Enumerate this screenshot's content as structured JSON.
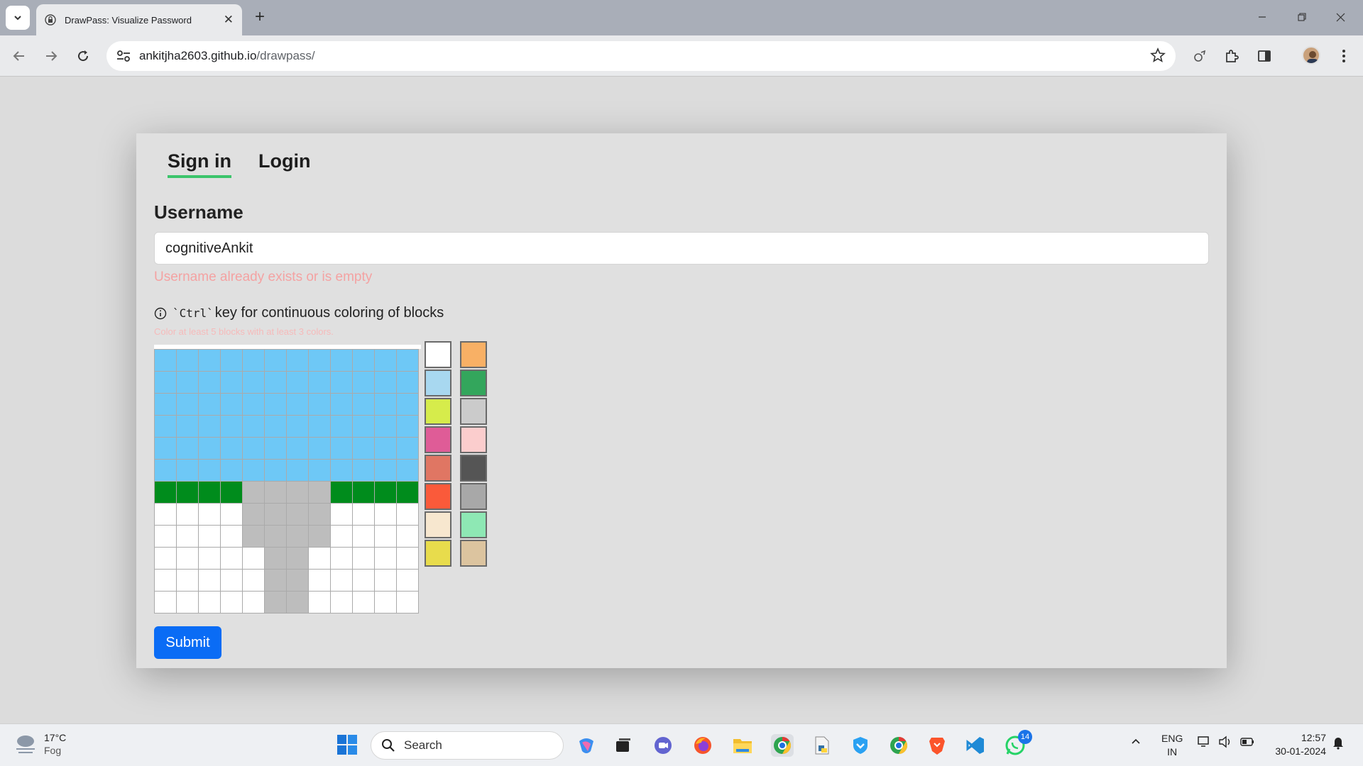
{
  "browser": {
    "tab_title": "DrawPass: Visualize Password",
    "url_host": "ankitjha2603.github.io",
    "url_path": "/drawpass/"
  },
  "page": {
    "tabs": [
      "Sign in",
      "Login"
    ],
    "active_tab": "Sign in",
    "username_label": "Username",
    "username_value": "cognitiveAnkit",
    "username_error": "Username already exists or is empty",
    "hint_code": "`Ctrl`",
    "hint_text": "key for continuous coloring of blocks",
    "grid_error": "Color at least 5 blocks with at least 3 colors.",
    "submit_label": "Submit",
    "grid_colors": [
      "#6ec8f6",
      "#008c1c",
      "#bdbdbd",
      "#ffffff"
    ],
    "grid_rows": [
      "AAAAAAAAAAAA",
      "AAAAAAAAAAAA",
      "AAAAAAAAAAAA",
      "AAAAAAAAAAAA",
      "AAAAAAAAAAAA",
      "AAAAAAAAAAAA",
      "BBBBCCCCBBBB",
      "WWWWCCCCWWWW",
      "WWWWCCCCWWWW",
      "WWWWWCCWWWWW",
      "WWWWWCCWWWWW",
      "WWWWWCCWWWWW"
    ],
    "palette_left": [
      "#ffffff",
      "#a8d8f0",
      "#d6ec4b",
      "#df5c97",
      "#e07663",
      "#fa5a3a",
      "#f7e7cf",
      "#e8dc4c"
    ],
    "palette_right": [
      "#f8b065",
      "#33a65c",
      "#cbcbcb",
      "#fbcdcd",
      "#555555",
      "#a8a8a8",
      "#8ee8b4",
      "#dcc49f"
    ]
  },
  "taskbar": {
    "weather_temp": "17°C",
    "weather_desc": "Fog",
    "search_placeholder": "Search",
    "whatsapp_badge": "14",
    "lang_top": "ENG",
    "lang_bottom": "IN",
    "time": "12:57",
    "date": "30-01-2024"
  }
}
